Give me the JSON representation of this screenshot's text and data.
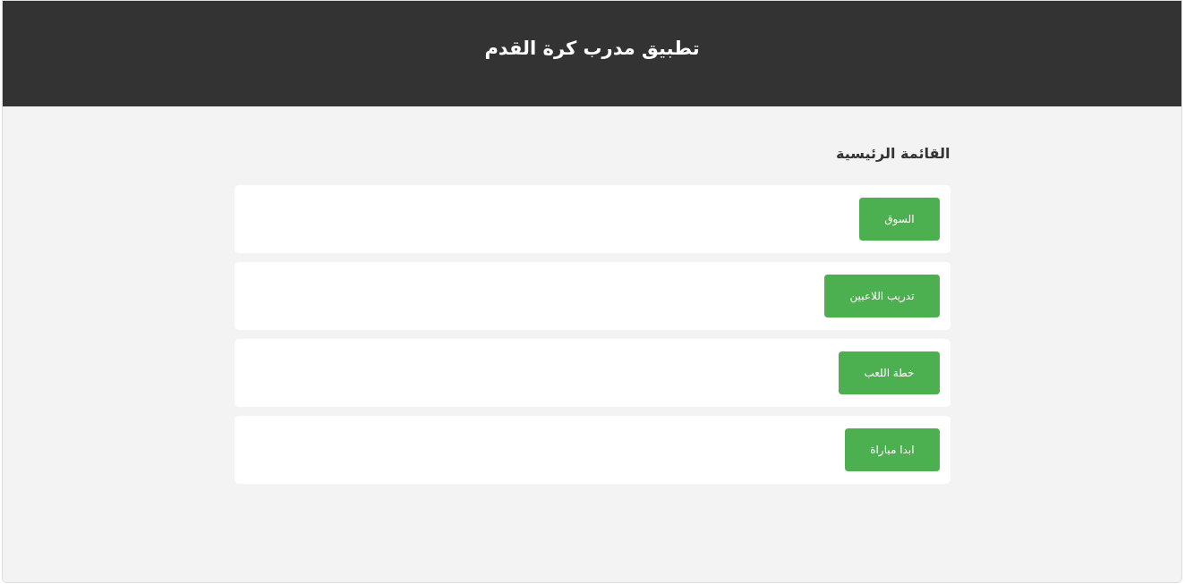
{
  "header": {
    "title": "تطبيق مدرب كرة القدم"
  },
  "menu": {
    "heading": "القائمة الرئيسية",
    "items": [
      {
        "label": "السوق"
      },
      {
        "label": "تدريب اللاعبين"
      },
      {
        "label": "خطة اللعب"
      },
      {
        "label": "ابدا مباراة"
      }
    ]
  }
}
